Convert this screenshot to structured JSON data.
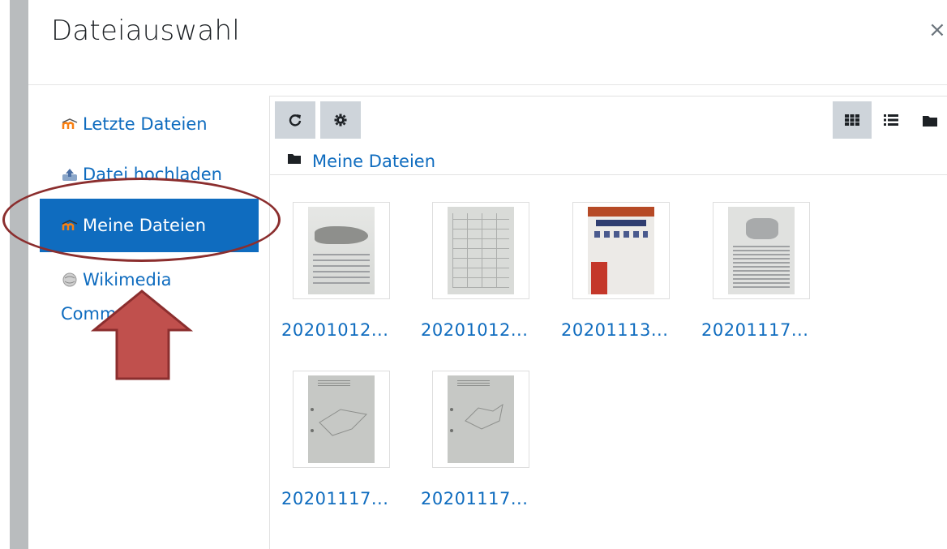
{
  "dialog": {
    "title": "Dateiauswahl",
    "close_glyph": "×"
  },
  "sidebar": {
    "items": [
      {
        "label": "Letzte Dateien",
        "icon": "moodle-icon",
        "active": false
      },
      {
        "label": "Datei hochladen",
        "icon": "upload-icon",
        "active": false
      },
      {
        "label": "Meine Dateien",
        "icon": "moodle-icon",
        "active": true
      },
      {
        "label": "Wikimedia",
        "label_line2": "Commons",
        "icon": "wikimedia-icon",
        "active": false
      }
    ]
  },
  "toolbar": {
    "refresh_icon": "refresh-icon",
    "settings_icon": "gear-icon",
    "view_modes": [
      "icons-view-icon",
      "list-view-icon",
      "tree-view-icon"
    ],
    "active_view": "icons-view-icon"
  },
  "path": {
    "folder_icon": "folder-icon",
    "label": "Meine Dateien"
  },
  "files": [
    {
      "name": "20201012..."
    },
    {
      "name": "20201012..."
    },
    {
      "name": "20201113..."
    },
    {
      "name": "20201117..."
    },
    {
      "name": "20201117..."
    },
    {
      "name": "20201117..."
    }
  ],
  "colors": {
    "accent": "#0f6cbf",
    "active_bg": "#0f6cbf",
    "toolbar_btn": "#ced4da",
    "annotation": "#8b2e2e",
    "arrow_fill": "#c0504d"
  }
}
